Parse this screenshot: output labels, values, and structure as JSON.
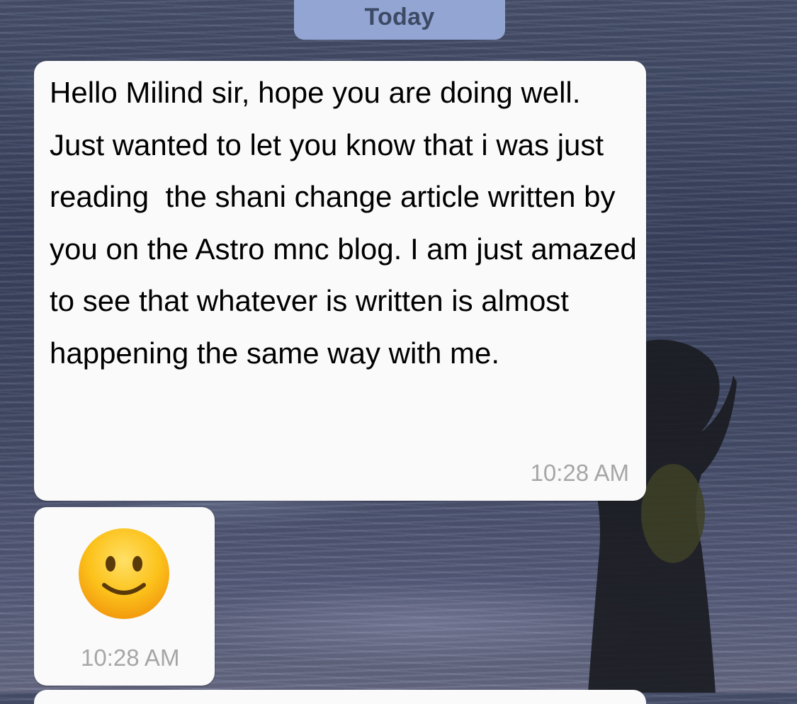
{
  "date_pill": {
    "label": "Today",
    "color": "#93a6d3"
  },
  "messages": [
    {
      "type": "text",
      "text": "Hello Milind sir, hope you are doing well. Just wanted to let you know that i was just reading  the shani change article written by you on the Astro mnc blog. I am just amazed to see that whatever is written is almost happening the same way with me.",
      "time": "10:28 AM"
    },
    {
      "type": "emoji",
      "emoji": "slightly-smiling-face-icon",
      "time": "10:28 AM"
    }
  ],
  "colors": {
    "bubble_bg": "#fafafa",
    "timestamp": "#a6a6a6",
    "wallpaper": "#454d6a"
  }
}
